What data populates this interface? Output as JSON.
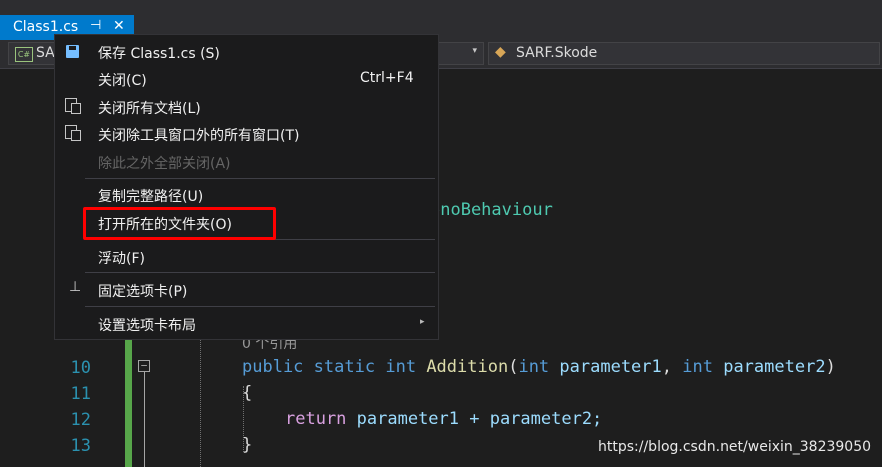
{
  "tab": {
    "title": "Class1.cs",
    "pin_glyph": "⊣",
    "close_glyph": "✕"
  },
  "navbar": {
    "project_icon_text": "C#",
    "project_label": "SA",
    "arrow": "▾",
    "class_label": "SARF.Skode",
    "class_icon": "◆"
  },
  "menu": {
    "items": [
      {
        "label": "保存 Class1.cs (S)",
        "icon": "save-icon"
      },
      {
        "label": "关闭(C)",
        "shortcut": "Ctrl+F4"
      },
      {
        "label": "关闭所有文档(L)",
        "icon": "close-all-documents-icon"
      },
      {
        "label": "关闭除工具窗口外的所有窗口(T)",
        "icon": "close-all-but-tool-windows-icon"
      },
      {
        "label": "除此之外全部关闭(A)",
        "disabled": true
      },
      {
        "label": "复制完整路径(U)"
      },
      {
        "label": "打开所在的文件夹(O)"
      },
      {
        "label": "浮动(F)"
      },
      {
        "label": "固定选项卡(P)",
        "icon": "pin-icon"
      },
      {
        "label": "设置选项卡布局",
        "submenu_arrow": "▸"
      }
    ]
  },
  "editor": {
    "visible_code_fragment": "onoBehaviour",
    "codelens": "0 个引用",
    "line_numbers": [
      "10",
      "11",
      "12",
      "13"
    ],
    "line10": {
      "kw1": "public",
      "kw2": "static",
      "kw3": "int",
      "fn": "Addition",
      "p1": "(",
      "t1": "int",
      "a1": " parameter1",
      "c": ", ",
      "t2": "int",
      "a2": " parameter2",
      "p2": ")"
    },
    "line11": "{",
    "line12": {
      "kw": "return",
      "rest": " parameter1 + parameter2;"
    },
    "line13": "}"
  },
  "watermark": "https://blog.csdn.net/weixin_38239050",
  "colors": {
    "accent": "#007acc",
    "highlight_box": "#ff0000",
    "line_number": "#2b91af",
    "keyword": "#569cd6"
  }
}
